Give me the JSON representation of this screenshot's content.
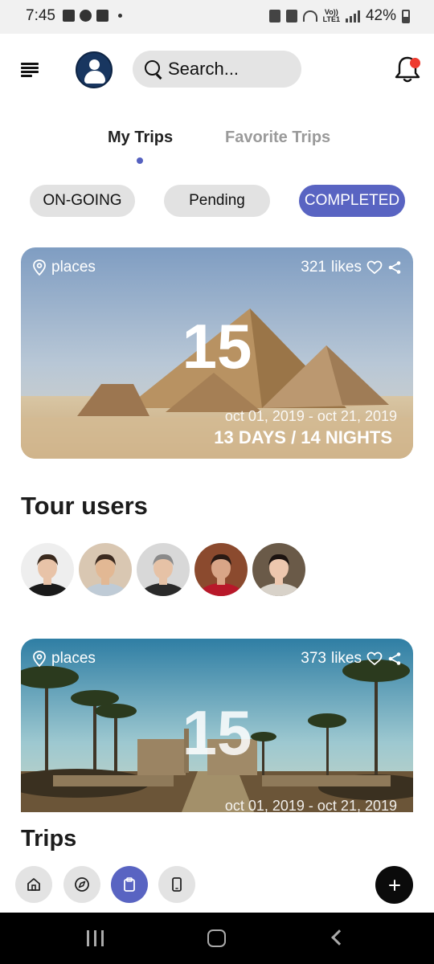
{
  "status_bar": {
    "time": "7:45",
    "battery": "42%",
    "network": "LTE1",
    "volte": "Vo))",
    "icons_left": [
      "gallery-icon",
      "facebook-icon",
      "box-icon",
      "dot-icon"
    ],
    "icons_right": [
      "lock-icon",
      "mute-icon",
      "wifi-icon",
      "signal-icon",
      "battery-icon"
    ]
  },
  "header": {
    "menu_icon": "hamburger-icon",
    "avatar_icon": "user-icon",
    "search_placeholder": "Search...",
    "notification_icon": "bell-icon",
    "notification_dot_color": "#ee3b2f"
  },
  "tabs": [
    {
      "label": "My Trips",
      "active": true
    },
    {
      "label": "Favorite Trips",
      "active": false
    }
  ],
  "filters": [
    {
      "label": "ON-GOING",
      "active": false
    },
    {
      "label": "Pending",
      "active": false
    },
    {
      "label": "COMPLETED",
      "active": true
    }
  ],
  "trips": [
    {
      "places_label": "places",
      "likes": "321",
      "likes_label": "likes",
      "big_number": "15",
      "dates": "oct 01, 2019 - oct 21, 2019",
      "duration": "13 DAYS / 14 NIGHTS",
      "scene": "pyramids"
    },
    {
      "places_label": "places",
      "likes": "373",
      "likes_label": "likes",
      "big_number": "15",
      "dates": "oct 01, 2019 - oct 21, 2019",
      "scene": "temple-avenue"
    }
  ],
  "tour_users": {
    "title": "Tour users",
    "users": [
      {
        "name": "user-1",
        "skin": "#e8c3a8",
        "hair": "#3a2a1e",
        "shirt": "#1a1a1a",
        "bg": "#eeeeee"
      },
      {
        "name": "user-2",
        "skin": "#e2b894",
        "hair": "#3b2a20",
        "shirt": "#bfcbd6",
        "bg": "#d9c7b2"
      },
      {
        "name": "user-3",
        "skin": "#e6c2a6",
        "hair": "#8a8a8a",
        "shirt": "#2a2a2a",
        "bg": "#d8d8d8"
      },
      {
        "name": "user-4",
        "skin": "#d9a587",
        "hair": "#2a1a14",
        "shirt": "#b8182a",
        "bg": "#8b4a2e"
      },
      {
        "name": "user-5",
        "skin": "#edc7ae",
        "hair": "#1c1310",
        "shirt": "#d8d2c9",
        "bg": "#6a5a48"
      }
    ]
  },
  "trips_section": {
    "title": "Trips"
  },
  "bottom_nav": {
    "items": [
      {
        "icon": "home-icon",
        "active": false
      },
      {
        "icon": "compass-icon",
        "active": false
      },
      {
        "icon": "clipboard-icon",
        "active": true
      },
      {
        "icon": "phone-icon",
        "active": false
      }
    ],
    "fab_icon": "plus-icon",
    "accent": "#5964c2"
  },
  "android_nav": [
    "recents-button",
    "home-button",
    "back-button"
  ]
}
